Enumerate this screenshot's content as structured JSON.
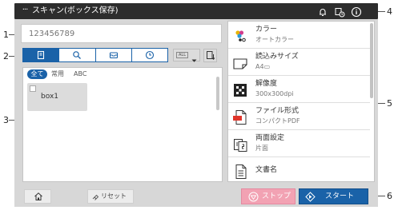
{
  "callouts": {
    "n1": "1",
    "n2": "2",
    "n3": "3",
    "n4": "4",
    "n5": "5",
    "n6": "6"
  },
  "titlebar": {
    "menu_label": "···",
    "title": "スキャン(ボックス保存)",
    "icons": [
      "bell-icon",
      "box-clock-icon",
      "info-icon"
    ]
  },
  "search": {
    "value": "",
    "placeholder": "123456789"
  },
  "toolbar": {
    "segments": [
      "box-select-icon",
      "search-icon",
      "box-tray-icon",
      "clock-icon"
    ],
    "active_segment": 0,
    "filter_dropdown": {
      "value": "ALL",
      "icon": "chevron-down-icon"
    },
    "sort_button_icon": "sort-icon"
  },
  "box_list": {
    "tabs": [
      {
        "label": "全て",
        "active": true
      },
      {
        "label": "常用",
        "active": false
      },
      {
        "label": "ABC",
        "active": false
      }
    ],
    "items": [
      {
        "name": "box1",
        "checked": false
      }
    ]
  },
  "settings": [
    {
      "label": "カラー",
      "value": "オートカラー",
      "icon": "color-icon"
    },
    {
      "label": "読込みサイズ",
      "value": "A4▭",
      "icon": "paper-size-icon"
    },
    {
      "label": "解像度",
      "value": "300x300dpi",
      "icon": "resolution-icon"
    },
    {
      "label": "ファイル形式",
      "value": "コンパクトPDF",
      "icon": "pdf-icon"
    },
    {
      "label": "両面設定",
      "value": "片面",
      "icon": "duplex-icon"
    },
    {
      "label": "文書名",
      "value": "",
      "icon": "document-icon"
    }
  ],
  "bottom_bar": {
    "home_icon": "home-icon",
    "reset_label": "リセット",
    "stop_label": "ストップ",
    "start_label": "スタート"
  },
  "colors": {
    "accent": "#1a62a8",
    "stop": "#f2a2b3",
    "titlebar": "#2d2d2d",
    "frame": "#d7d7d7"
  }
}
